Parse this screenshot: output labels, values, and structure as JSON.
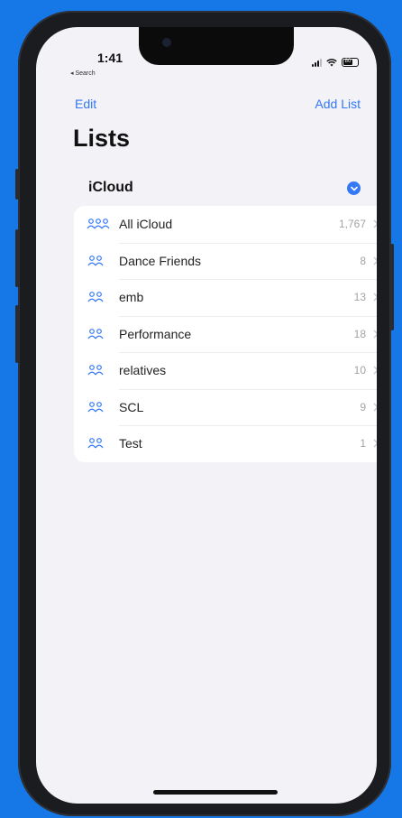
{
  "status": {
    "time": "1:41",
    "back_label": "◂ Search",
    "battery": "80"
  },
  "nav": {
    "edit_label": "Edit",
    "add_list_label": "Add List"
  },
  "page": {
    "title": "Lists"
  },
  "section": {
    "title": "iCloud"
  },
  "lists": [
    {
      "label": "All iCloud",
      "count": "1,767",
      "icon": "group-people-icon"
    },
    {
      "label": "Dance Friends",
      "count": "8",
      "icon": "people-icon"
    },
    {
      "label": "emb",
      "count": "13",
      "icon": "people-icon"
    },
    {
      "label": "Performance",
      "count": "18",
      "icon": "people-icon"
    },
    {
      "label": "relatives",
      "count": "10",
      "icon": "people-icon"
    },
    {
      "label": "SCL",
      "count": "9",
      "icon": "people-icon"
    },
    {
      "label": "Test",
      "count": "1",
      "icon": "people-icon"
    }
  ],
  "colors": {
    "accent": "#3478f6",
    "background": "#1677e6",
    "screen": "#f2f2f7"
  }
}
